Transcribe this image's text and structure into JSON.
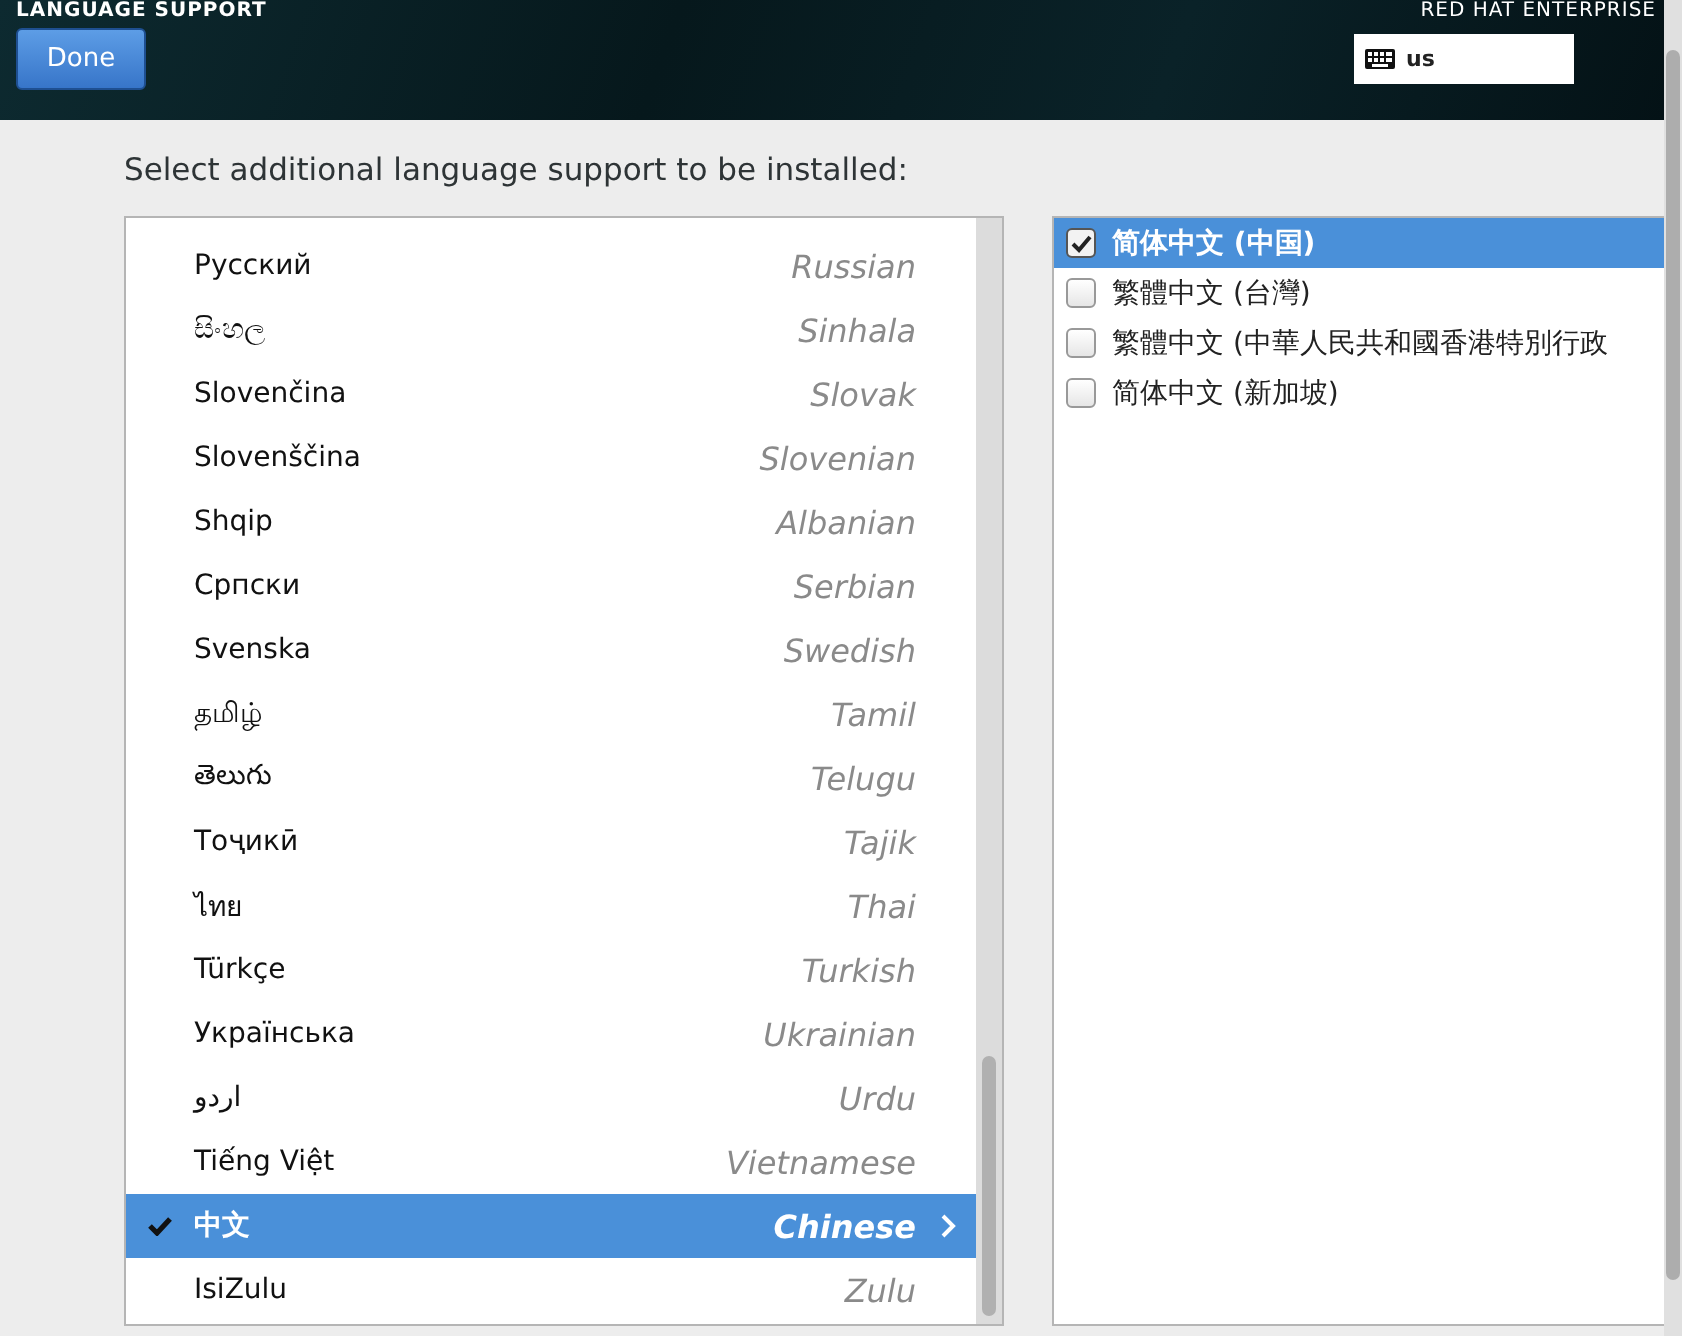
{
  "header": {
    "title": "LANGUAGE SUPPORT",
    "brand": "RED HAT ENTERPRISE",
    "done_button": "Done",
    "keyboard_layout": "us"
  },
  "prompt": "Select additional language support to be installed:",
  "languages": [
    {
      "native": "Русский",
      "english": "Russian",
      "selected": false,
      "checked": false
    },
    {
      "native": "සිංහල",
      "english": "Sinhala",
      "selected": false,
      "checked": false
    },
    {
      "native": "Slovenčina",
      "english": "Slovak",
      "selected": false,
      "checked": false
    },
    {
      "native": "Slovenščina",
      "english": "Slovenian",
      "selected": false,
      "checked": false
    },
    {
      "native": "Shqip",
      "english": "Albanian",
      "selected": false,
      "checked": false
    },
    {
      "native": "Српски",
      "english": "Serbian",
      "selected": false,
      "checked": false
    },
    {
      "native": "Svenska",
      "english": "Swedish",
      "selected": false,
      "checked": false
    },
    {
      "native": "தமிழ்",
      "english": "Tamil",
      "selected": false,
      "checked": false
    },
    {
      "native": "తెలుగు",
      "english": "Telugu",
      "selected": false,
      "checked": false
    },
    {
      "native": "Тоҷикӣ",
      "english": "Tajik",
      "selected": false,
      "checked": false
    },
    {
      "native": "ไทย",
      "english": "Thai",
      "selected": false,
      "checked": false
    },
    {
      "native": "Türkçe",
      "english": "Turkish",
      "selected": false,
      "checked": false
    },
    {
      "native": "Українська",
      "english": "Ukrainian",
      "selected": false,
      "checked": false
    },
    {
      "native": "اردو",
      "english": "Urdu",
      "selected": false,
      "checked": false
    },
    {
      "native": "Tiếng Việt",
      "english": "Vietnamese",
      "selected": false,
      "checked": false
    },
    {
      "native": "中文",
      "english": "Chinese",
      "selected": true,
      "checked": true
    },
    {
      "native": "IsiZulu",
      "english": "Zulu",
      "selected": false,
      "checked": false
    }
  ],
  "locales": [
    {
      "label": "简体中文 (中国)",
      "checked": true,
      "selected": true
    },
    {
      "label": "繁體中文 (台灣)",
      "checked": false,
      "selected": false
    },
    {
      "label": "繁體中文 (中華人民共和國香港特別行政",
      "checked": false,
      "selected": false
    },
    {
      "label": "简体中文 (新加坡)",
      "checked": false,
      "selected": false
    }
  ]
}
